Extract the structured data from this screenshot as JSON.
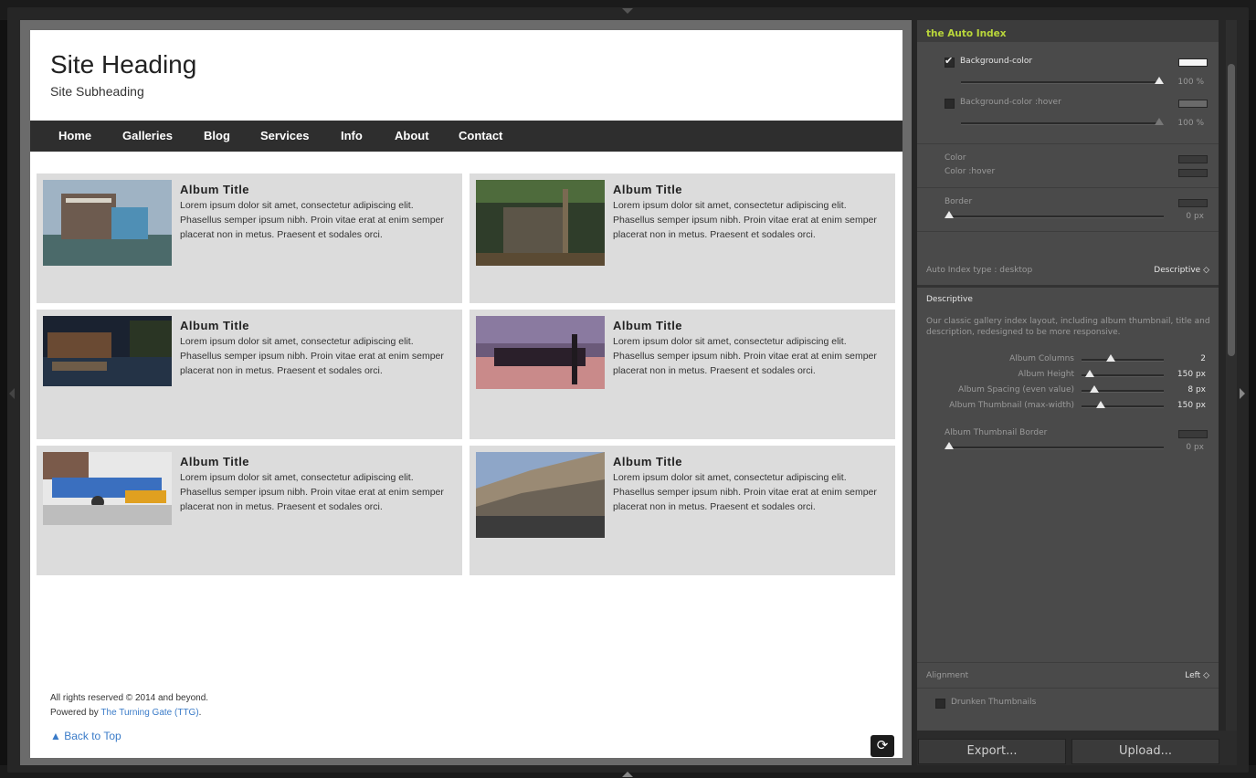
{
  "site": {
    "heading": "Site Heading",
    "subheading": "Site Subheading",
    "nav": [
      "Home",
      "Galleries",
      "Blog",
      "Services",
      "Info",
      "About",
      "Contact"
    ],
    "albums": [
      {
        "title": "Album Title",
        "desc": "Lorem ipsum dolor sit amet, consectetur adipiscing elit. Phasellus semper ipsum nibh. Proin vitae erat at enim semper placerat non in metus. Praesent et sodales orci."
      },
      {
        "title": "Album Title",
        "desc": "Lorem ipsum dolor sit amet, consectetur adipiscing elit. Phasellus semper ipsum nibh. Proin vitae erat at enim semper placerat non in metus. Praesent et sodales orci."
      },
      {
        "title": "Album Title",
        "desc": "Lorem ipsum dolor sit amet, consectetur adipiscing elit. Phasellus semper ipsum nibh. Proin vitae erat at enim semper placerat non in metus. Praesent et sodales orci."
      },
      {
        "title": "Album Title",
        "desc": "Lorem ipsum dolor sit amet, consectetur adipiscing elit. Phasellus semper ipsum nibh. Proin vitae erat at enim semper placerat non in metus. Praesent et sodales orci."
      },
      {
        "title": "Album Title",
        "desc": "Lorem ipsum dolor sit amet, consectetur adipiscing elit. Phasellus semper ipsum nibh. Proin vitae erat at enim semper placerat non in metus. Praesent et sodales orci."
      },
      {
        "title": "Album Title",
        "desc": "Lorem ipsum dolor sit amet, consectetur adipiscing elit. Phasellus semper ipsum nibh. Proin vitae erat at enim semper placerat non in metus. Praesent et sodales orci."
      }
    ],
    "footer": {
      "rights": "All rights reserved © 2014 and beyond.",
      "powered_prefix": "Powered by ",
      "powered_link": "The Turning Gate (TTG)",
      "powered_suffix": ".",
      "back_to_top": "▲ Back to Top",
      "refresh_glyph": "⟳"
    }
  },
  "panel": {
    "title": "the Auto Index",
    "bg_color_label": "Background-color",
    "bg_color_checked": true,
    "bg_color_value": "100 %",
    "bg_hover_label": "Background-color :hover",
    "bg_hover_checked": false,
    "bg_hover_value": "100 %",
    "color_label": "Color",
    "color_hover_label": "Color :hover",
    "border_label": "Border",
    "border_value": "0 px",
    "index_type_label": "Auto Index type : desktop",
    "index_type_value": "Descriptive ◇",
    "section_title": "Descriptive",
    "section_desc": "Our classic gallery index layout, including album thumbnail, title and description, redesigned to be more responsive.",
    "sliders": [
      {
        "label": "Album Columns",
        "value": "2",
        "level": 0.35
      },
      {
        "label": "Album Height",
        "value": "150 px",
        "level": 0.1
      },
      {
        "label": "Album Spacing (even value)",
        "value": "8 px",
        "level": 0.1
      },
      {
        "label": "Album Thumbnail (max-width)",
        "value": "150 px",
        "level": 0.2
      }
    ],
    "thumb_border_label": "Album Thumbnail Border",
    "thumb_border_value": "0 px",
    "alignment_label": "Alignment",
    "alignment_value": "Left ◇",
    "drunken_label": "Drunken Thumbnails",
    "export_label": "Export...",
    "upload_label": "Upload...",
    "colors": {
      "accent": "#b9d63a",
      "swatch_white": "#f5f5f5"
    }
  }
}
